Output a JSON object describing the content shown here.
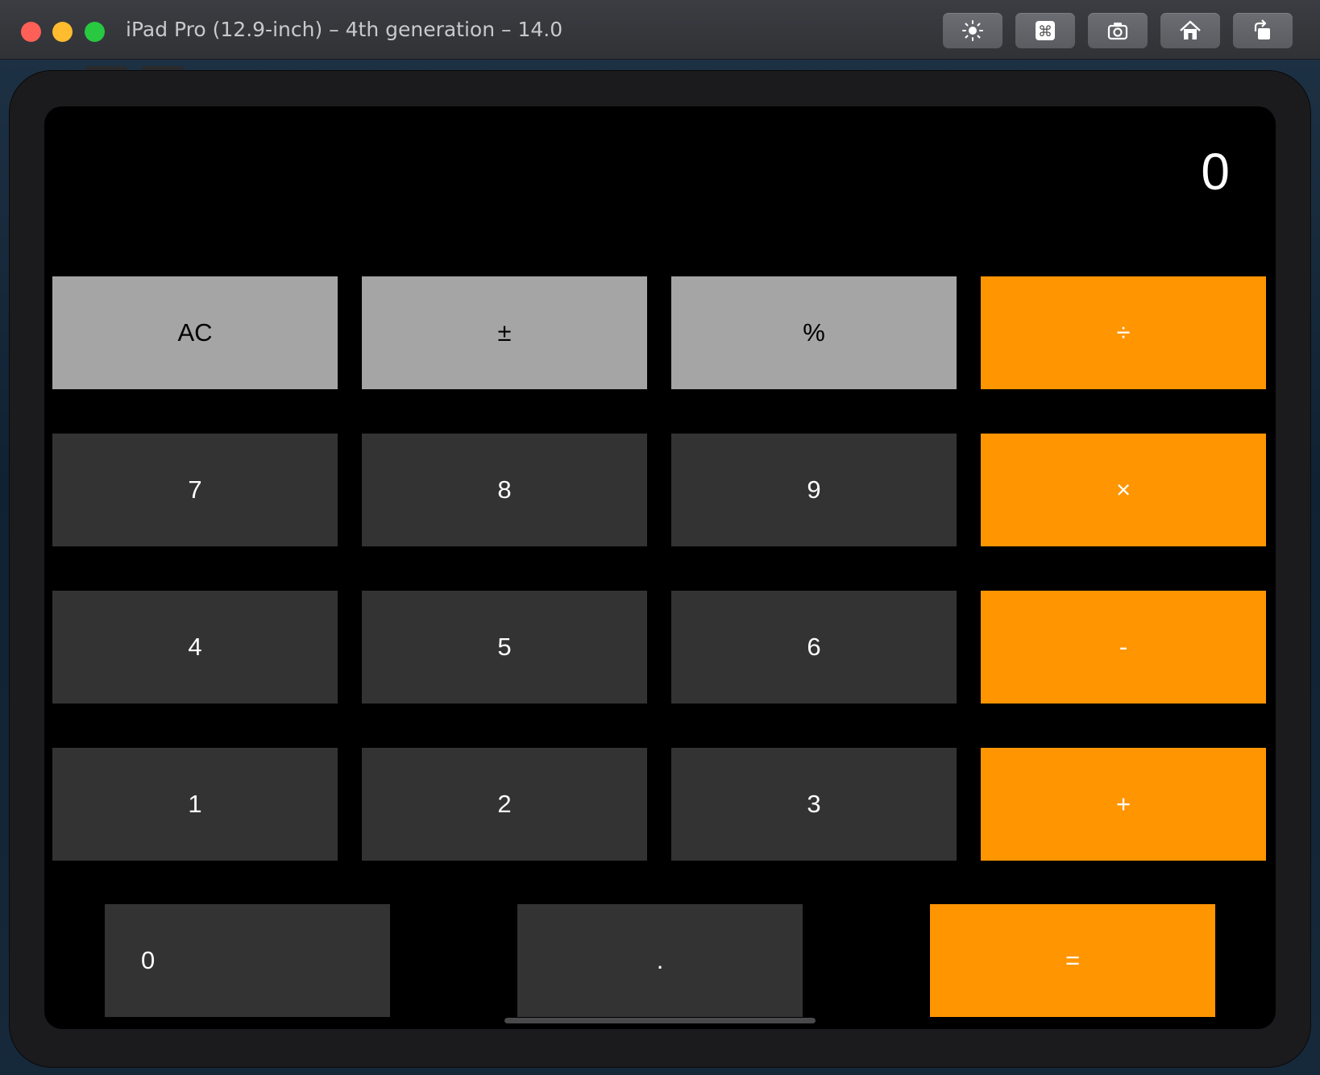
{
  "window": {
    "title": "iPad Pro (12.9-inch) – 4th generation – 14.0",
    "toolbar_buttons": [
      {
        "name": "brightness-icon"
      },
      {
        "name": "command-key-icon"
      },
      {
        "name": "camera-icon"
      },
      {
        "name": "home-icon"
      },
      {
        "name": "rotate-icon"
      }
    ]
  },
  "calculator": {
    "display": "0",
    "keys": {
      "ac": "AC",
      "plus_minus": "±",
      "percent": "%",
      "divide": "÷",
      "seven": "7",
      "eight": "8",
      "nine": "9",
      "multiply": "×",
      "four": "4",
      "five": "5",
      "six": "6",
      "minus": "-",
      "one": "1",
      "two": "2",
      "three": "3",
      "plus": "+",
      "zero": "0",
      "decimal": ".",
      "equals": "="
    }
  },
  "colors": {
    "function_key": "#a5a5a5",
    "digit_key": "#333333",
    "operator_key": "#ff9500",
    "screen_background": "#000000"
  }
}
